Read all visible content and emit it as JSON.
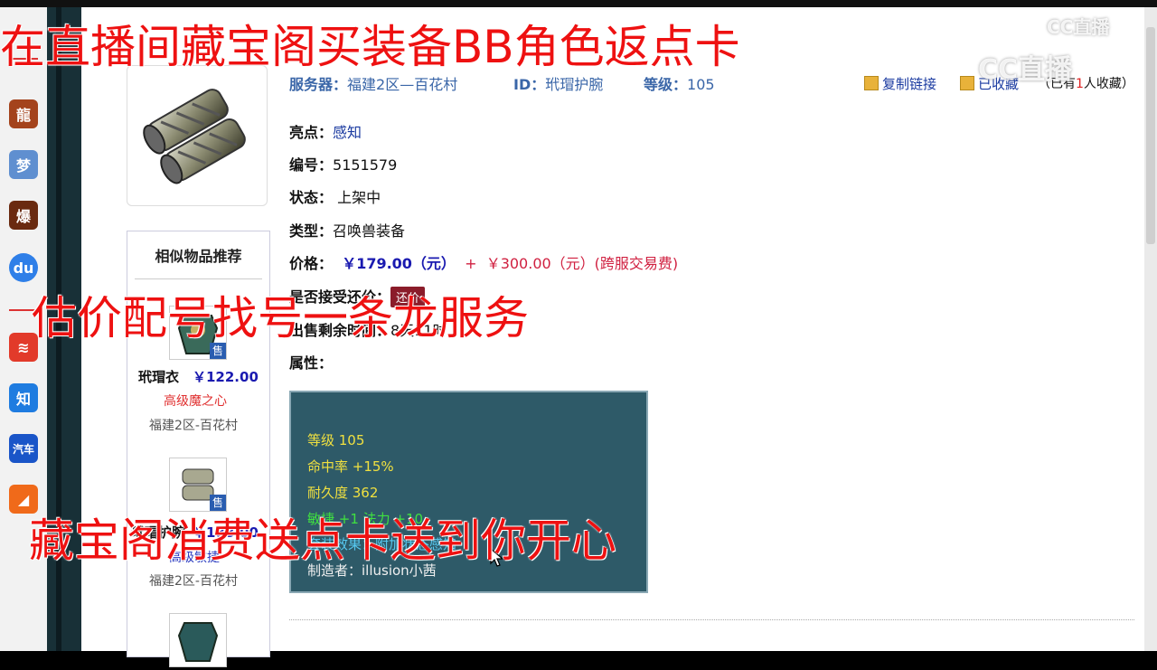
{
  "overlays": {
    "line1": "在直播间藏宝阁买装备BB角色返点卡",
    "line2": "估价配号找号一条龙服务",
    "line3": "藏宝阁消费送点卡送到你开心"
  },
  "watermark": {
    "small": "CC直播",
    "large": "CC直播"
  },
  "leftbar": {
    "icons": [
      "dragon-game-icon",
      "fantasy-game-icon",
      "explosion-game-icon",
      "baidu-icon",
      "scroll-app-icon",
      "zhihu-icon",
      "car-app-icon",
      "video-app-icon"
    ],
    "labels": {
      "zhihu": "知",
      "car": "汽车"
    }
  },
  "header": {
    "server_label": "服务器：",
    "server_value": "福建2区—百花村",
    "id_label": "ID：",
    "id_value": "玳瑁护腕",
    "level_label": "等级：",
    "level_value": "105",
    "copy_link": "复制链接",
    "favorited": "已收藏",
    "fav_count_pre": "（已有",
    "fav_count": "1",
    "fav_count_post": "人收藏）"
  },
  "details": {
    "highlight_label": "亮点：",
    "highlight_value": "感知",
    "number_label": "编号：",
    "number_value": "5151579",
    "status_label": "状态：",
    "status_value": "上架中",
    "type_label": "类型：",
    "type_value": "召唤兽装备",
    "price_label": "价格：",
    "price_value": "￥179.00（元）",
    "price_plus": "+",
    "fee_value": "￥300.00（元）(跨服交易费)",
    "bargain_label": "是否接受还价：",
    "bargain_button": "还价",
    "remaining_label": "出售剩余时间：",
    "remaining_value": "8天11时",
    "attr_label": "属性："
  },
  "attributes": {
    "level": "等级 105",
    "hit": "命中率 +15%",
    "durability": "耐久度 362",
    "agility": "敏捷 +1 法力 +10",
    "extra_prefix": "套装效果：",
    "extra_value": "附加状态感知",
    "maker": "制造者：illusion小茜"
  },
  "similar": {
    "title": "相似物品推荐",
    "sold_badge": "售",
    "items": [
      {
        "name": "玳瑁衣",
        "price": "￥122.00",
        "sub": "高级魔之心",
        "location": "福建2区-百花村",
        "sub_color": "#e03030"
      },
      {
        "name": "玳瑁护腕",
        "price": "￥188.00",
        "sub": "高级敏捷",
        "location": "福建2区-百花村",
        "sub_color": "#2a3ac0"
      }
    ]
  }
}
